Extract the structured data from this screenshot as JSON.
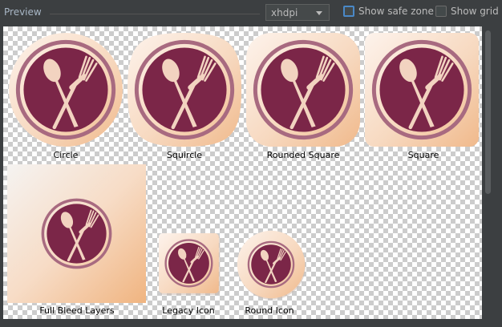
{
  "toolbar": {
    "preview_label": "Preview",
    "density_value": "xhdpi",
    "show_safe_zone_label": "Show safe zone",
    "show_safe_zone_checked": false,
    "show_grid_label": "Show grid",
    "show_grid_checked": false
  },
  "icons": [
    {
      "label": "Circle",
      "shape": "circle"
    },
    {
      "label": "Squircle",
      "shape": "squircle"
    },
    {
      "label": "Rounded Square",
      "shape": "rounded-square"
    },
    {
      "label": "Square",
      "shape": "square"
    },
    {
      "label": "Full Bleed Layers",
      "shape": "full-bleed"
    },
    {
      "label": "Legacy Icon",
      "shape": "legacy"
    },
    {
      "label": "Round Icon",
      "shape": "round"
    }
  ],
  "colors": {
    "plate": "#7b2648",
    "plate_ring": "#a36078",
    "utensils": "#f2d3c0",
    "bg_light": "#fbeee6",
    "bg_dark": "#f1be94"
  }
}
